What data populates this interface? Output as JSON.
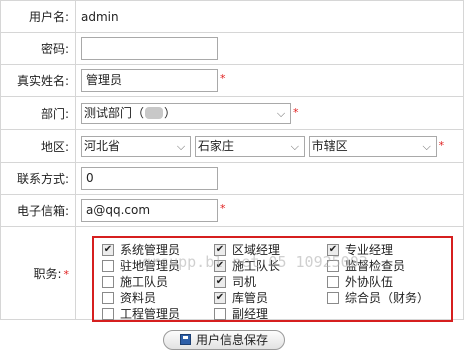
{
  "form": {
    "username_label": "用户名:",
    "username_value": "admin",
    "password_label": "密码:",
    "password_value": "",
    "realname_label": "真实姓名:",
    "realname_value": "管理员",
    "dept_label": "部门:",
    "dept_value_prefix": "测试部门（",
    "dept_value_suffix": "）",
    "area_label": "地区:",
    "province_value": "河北省",
    "city_value": "石家庄",
    "district_value": "市辖区",
    "contact_label": "联系方式:",
    "contact_value": "0",
    "email_label": "电子信箱:",
    "email_value": "a@qq.com",
    "role_label": "职务:",
    "required_mark": "*"
  },
  "roles": [
    {
      "label": "系统管理员",
      "checked": true
    },
    {
      "label": "区域经理",
      "checked": true
    },
    {
      "label": "专业经理",
      "checked": true
    },
    {
      "label": "驻地管理员",
      "checked": false
    },
    {
      "label": "施工队长",
      "checked": true
    },
    {
      "label": "监督检查员",
      "checked": false
    },
    {
      "label": "施工队员",
      "checked": false
    },
    {
      "label": "司机",
      "checked": true
    },
    {
      "label": "外协队伍",
      "checked": false
    },
    {
      "label": "资料员",
      "checked": false
    },
    {
      "label": "库管员",
      "checked": true
    },
    {
      "label": "综合员（财务）",
      "checked": false
    },
    {
      "label": "工程管理员",
      "checked": false
    },
    {
      "label": "副经理",
      "checked": false
    }
  ],
  "watermark": "grsupp.bl net 05 10925003",
  "save_button_label": "用户信息保存",
  "colors": {
    "required": "#e02020",
    "highlight_border": "#d61f1f",
    "grid_border": "#d6d6d6"
  }
}
